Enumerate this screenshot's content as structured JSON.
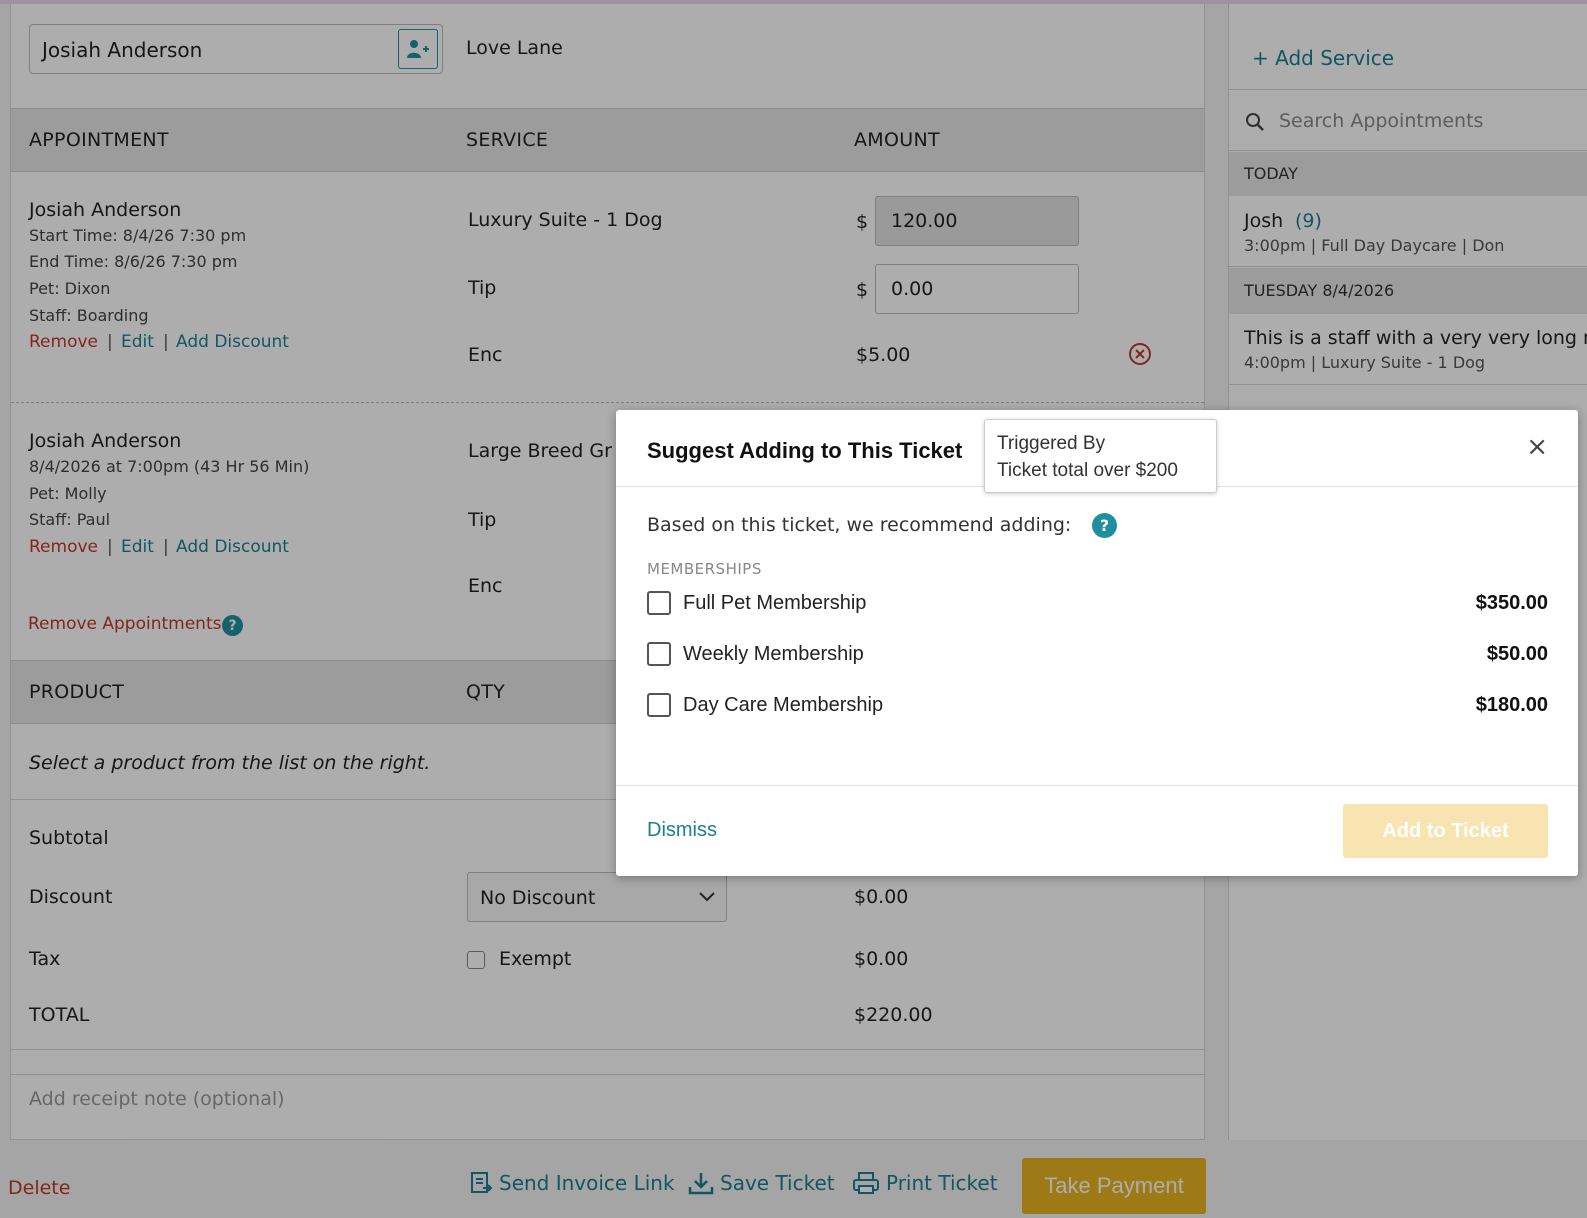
{
  "client": {
    "name": "Josiah Anderson",
    "location": "Love Lane"
  },
  "table_head": {
    "col1": "APPOINTMENT",
    "col2": "SERVICE",
    "col3": "AMOUNT"
  },
  "appt1": {
    "name": "Josiah Anderson",
    "start": "Start Time: 8/4/26 7:30 pm",
    "end": "End Time: 8/6/26 7:30 pm",
    "pet": "Pet: Dixon",
    "staff": "Staff: Boarding",
    "service": "Luxury Suite - 1 Dog",
    "amount": "120.00",
    "tip_label": "Tip",
    "tip": "0.00",
    "enc_label": "Enc",
    "enc": "$5.00"
  },
  "appt2": {
    "name": "Josiah Anderson",
    "time": "8/4/2026 at 7:00pm (43 Hr 56 Min)",
    "pet": "Pet: Molly",
    "staff": "Staff: Paul",
    "service": "Large Breed Gr",
    "tip_label": "Tip",
    "enc_label": "Enc"
  },
  "actions": {
    "remove": "Remove",
    "edit": "Edit",
    "add_discount": "Add Discount",
    "sep": "|",
    "dollar": "$"
  },
  "remove_appointments": "Remove Appointments",
  "product_head": {
    "col1": "PRODUCT",
    "col2": "QTY"
  },
  "product_placeholder": "Select a product from the list on the right.",
  "totals": {
    "subtotal_label": "Subtotal",
    "discount_label": "Discount",
    "discount_select": "No Discount",
    "discount_value": "$0.00",
    "tax_label": "Tax",
    "exempt_label": "Exempt",
    "tax_value": "$0.00",
    "total_label": "TOTAL",
    "total_value": "$220.00"
  },
  "receipt_note_placeholder": "Add receipt note (optional)",
  "bottom": {
    "delete": "Delete",
    "send_invoice": "Send Invoice Link",
    "save_ticket": "Save Ticket",
    "print_ticket": "Print Ticket",
    "take_payment": "Take Payment"
  },
  "sidebar": {
    "add_service": "+ Add Service",
    "search_placeholder": "Search Appointments",
    "today_label": "TODAY",
    "today_item": {
      "name": "Josh",
      "count": "(9)",
      "detail": "3:00pm | Full Day Daycare | Don"
    },
    "tuesday_label": "TUESDAY 8/4/2026",
    "tuesday_item": {
      "name": "This is a staff with a very very long n",
      "detail": "4:00pm | Luxury Suite - 1 Dog"
    }
  },
  "modal": {
    "title": "Suggest Adding to This Ticket",
    "intro": "Based on this ticket, we recommend adding:",
    "section": "MEMBERSHIPS",
    "items": [
      {
        "label": "Full Pet Membership",
        "price": "$350.00"
      },
      {
        "label": "Weekly Membership",
        "price": "$50.00"
      },
      {
        "label": "Day Care Membership",
        "price": "$180.00"
      }
    ],
    "dismiss": "Dismiss",
    "add": "Add to Ticket",
    "close": "×"
  },
  "tooltip": {
    "line1": "Triggered By",
    "line2": "Ticket total over $200"
  }
}
